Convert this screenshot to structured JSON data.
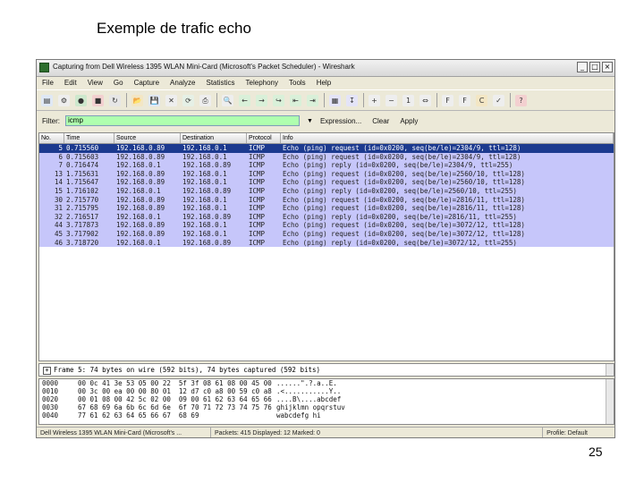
{
  "slide": {
    "title": "Exemple de trafic echo",
    "page_number": "25"
  },
  "window": {
    "title": "Capturing from Dell Wireless 1395 WLAN Mini-Card (Microsoft's Packet Scheduler) - Wireshark",
    "buttons": {
      "minimize": "_",
      "maximize": "□",
      "close": "×"
    }
  },
  "menu": [
    "File",
    "Edit",
    "View",
    "Go",
    "Capture",
    "Analyze",
    "Statistics",
    "Telephony",
    "Tools",
    "Help"
  ],
  "filter": {
    "label": "Filter:",
    "value": "icmp",
    "expression_label": "Expression...",
    "clear_label": "Clear",
    "apply_label": "Apply"
  },
  "packet_list": {
    "columns": [
      "No.",
      "Time",
      "Source",
      "Destination",
      "Protocol",
      "Info"
    ],
    "rows": [
      {
        "no": "5",
        "time": "0.715560",
        "src": "192.168.0.89",
        "dst": "192.168.0.1",
        "proto": "ICMP",
        "info": "Echo (ping) request  (id=0x0200, seq(be/le)=2304/9, ttl=128)"
      },
      {
        "no": "6",
        "time": "0.715603",
        "src": "192.168.0.89",
        "dst": "192.168.0.1",
        "proto": "ICMP",
        "info": "Echo (ping) request  (id=0x0200, seq(be/le)=2304/9, ttl=128)"
      },
      {
        "no": "7",
        "time": "0.716474",
        "src": "192.168.0.1",
        "dst": "192.168.0.89",
        "proto": "ICMP",
        "info": "Echo (ping) reply    (id=0x0200, seq(be/le)=2304/9, ttl=255)"
      },
      {
        "no": "13",
        "time": "1.715631",
        "src": "192.168.0.89",
        "dst": "192.168.0.1",
        "proto": "ICMP",
        "info": "Echo (ping) request  (id=0x0200, seq(be/le)=2560/10, ttl=128)"
      },
      {
        "no": "14",
        "time": "1.715647",
        "src": "192.168.0.89",
        "dst": "192.168.0.1",
        "proto": "ICMP",
        "info": "Echo (ping) request  (id=0x0200, seq(be/le)=2560/10, ttl=128)"
      },
      {
        "no": "15",
        "time": "1.716102",
        "src": "192.168.0.1",
        "dst": "192.168.0.89",
        "proto": "ICMP",
        "info": "Echo (ping) reply    (id=0x0200, seq(be/le)=2560/10, ttl=255)"
      },
      {
        "no": "30",
        "time": "2.715770",
        "src": "192.168.0.89",
        "dst": "192.168.0.1",
        "proto": "ICMP",
        "info": "Echo (ping) request  (id=0x0200, seq(be/le)=2816/11, ttl=128)"
      },
      {
        "no": "31",
        "time": "2.715795",
        "src": "192.168.0.89",
        "dst": "192.168.0.1",
        "proto": "ICMP",
        "info": "Echo (ping) request  (id=0x0200, seq(be/le)=2816/11, ttl=128)"
      },
      {
        "no": "32",
        "time": "2.716517",
        "src": "192.168.0.1",
        "dst": "192.168.0.89",
        "proto": "ICMP",
        "info": "Echo (ping) reply    (id=0x0200, seq(be/le)=2816/11, ttl=255)"
      },
      {
        "no": "44",
        "time": "3.717873",
        "src": "192.168.0.89",
        "dst": "192.168.0.1",
        "proto": "ICMP",
        "info": "Echo (ping) request  (id=0x0200, seq(be/le)=3072/12, ttl=128)"
      },
      {
        "no": "45",
        "time": "3.717902",
        "src": "192.168.0.89",
        "dst": "192.168.0.1",
        "proto": "ICMP",
        "info": "Echo (ping) request  (id=0x0200, seq(be/le)=3072/12, ttl=128)"
      },
      {
        "no": "46",
        "time": "3.718720",
        "src": "192.168.0.1",
        "dst": "192.168.0.89",
        "proto": "ICMP",
        "info": "Echo (ping) reply    (id=0x0200, seq(be/le)=3072/12, ttl=255)"
      }
    ]
  },
  "detail": {
    "expander": "⊞",
    "text": "Frame 5: 74 bytes on wire (592 bits), 74 bytes captured (592 bits)"
  },
  "bytes": [
    {
      "off": "0000",
      "hex": "00 0c 41 3e 53 05 00 22  5f 3f 08 61 08 00 45 00",
      "asc": "......\".?.a..E."
    },
    {
      "off": "0010",
      "hex": "00 3c 00 ea 00 00 80 01  12 d7 c0 a8 00 59 c0 a8",
      "asc": ".<...........Y.."
    },
    {
      "off": "0020",
      "hex": "00 01 08 00 42 5c 02 00  09 00 61 62 63 64 65 66",
      "asc": "....B\\....abcdef"
    },
    {
      "off": "0030",
      "hex": "67 68 69 6a 6b 6c 6d 6e  6f 70 71 72 73 74 75 76",
      "asc": "ghijklmn opqrstuv"
    },
    {
      "off": "0040",
      "hex": "77 61 62 63 64 65 66 67  68 69",
      "asc": "wabcdefg hi"
    }
  ],
  "status": {
    "interface": "Dell Wireless 1395 WLAN Mini-Card (Microsoft's ...",
    "packets": "Packets: 415 Displayed: 12 Marked: 0",
    "profile": "Profile: Default"
  },
  "toolbar_icons": [
    "interface-list-icon",
    "capture-options-icon",
    "start-capture-icon",
    "stop-capture-icon",
    "restart-capture-icon",
    "open-icon",
    "save-icon",
    "close-file-icon",
    "reload-icon",
    "print-icon",
    "find-icon",
    "back-icon",
    "forward-icon",
    "go-to-icon",
    "first-packet-icon",
    "last-packet-icon",
    "colorize-icon",
    "autoscroll-icon",
    "zoom-in-icon",
    "zoom-out-icon",
    "normal-size-icon",
    "resize-columns-icon",
    "capture-filters-icon",
    "display-filters-icon",
    "coloring-rules-icon",
    "preferences-icon",
    "help-icon"
  ]
}
